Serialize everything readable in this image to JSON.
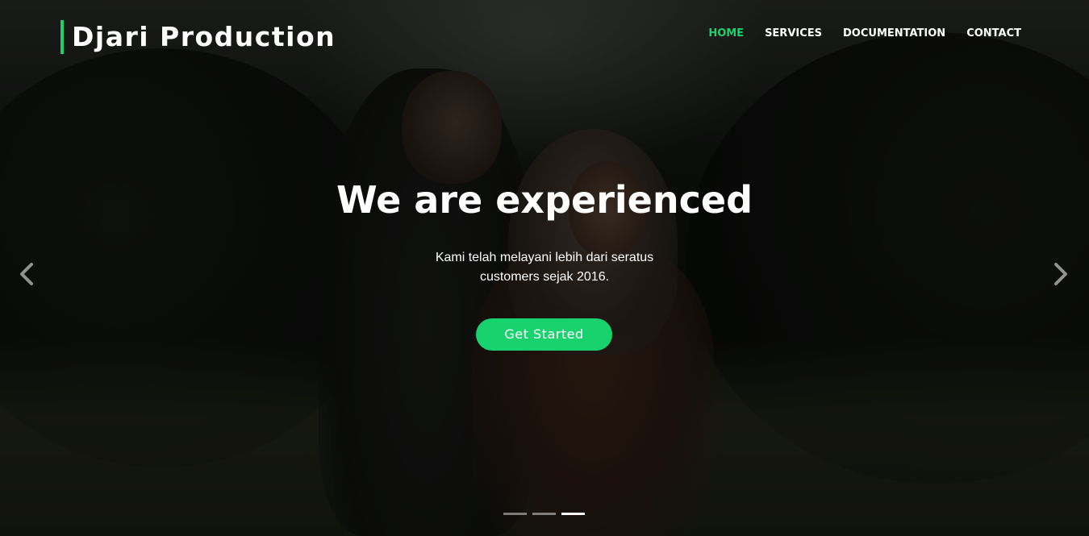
{
  "header": {
    "logo_text": "Djari Production",
    "nav": [
      {
        "label": "HOME",
        "active": true
      },
      {
        "label": "SERVICES",
        "active": false
      },
      {
        "label": "DOCUMENTATION",
        "active": false
      },
      {
        "label": "CONTACT",
        "active": false
      }
    ]
  },
  "hero": {
    "title": "We are experienced",
    "text_line1": "Kami telah melayani lebih dari seratus",
    "text_line2": "customers sejak 2016.",
    "cta_label": "Get Started",
    "prev_icon": "chevron-left-icon",
    "next_icon": "chevron-right-icon",
    "slides_total": 3,
    "active_slide": 3
  },
  "colors": {
    "accent": "#18d26e",
    "text": "#ffffff",
    "overlay": "rgba(0,0,0,0.38)"
  }
}
